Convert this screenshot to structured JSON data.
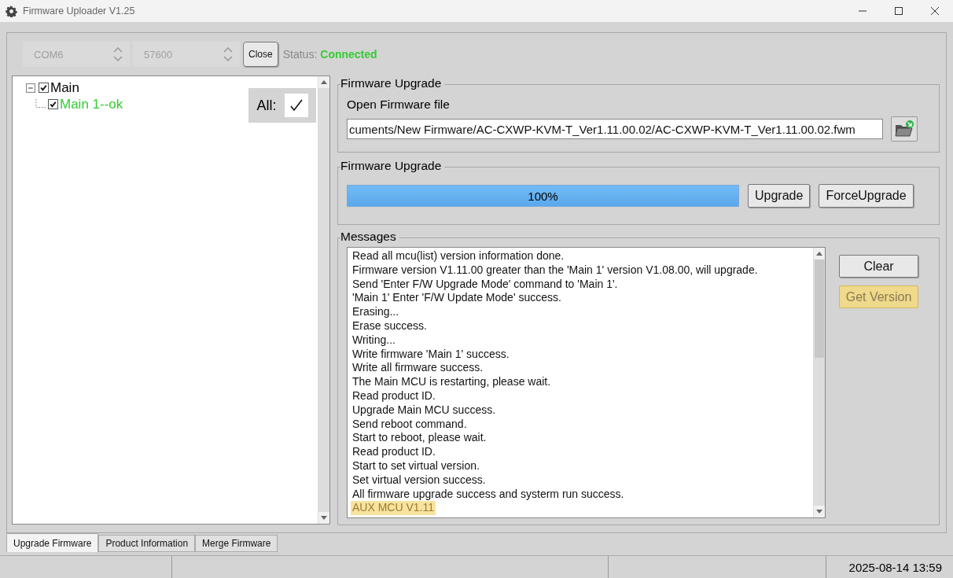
{
  "window": {
    "title": "Firmware Uploader V1.25"
  },
  "connection": {
    "port": {
      "value": "COM6",
      "disabled": true
    },
    "baud": {
      "value": "57600",
      "disabled": true
    },
    "button": "Close",
    "status_label": "Status:",
    "status_value": "Connected"
  },
  "tree": {
    "items": [
      {
        "label": "Main",
        "checked": true,
        "expanded": true,
        "children": [
          {
            "label": "Main 1--ok",
            "checked": true,
            "color": "#33cc33"
          }
        ]
      }
    ],
    "all_label": "All:",
    "all_checked": true
  },
  "file_group": {
    "title": "Firmware Upgrade",
    "label": "Open Firmware file",
    "path": "cuments/New Firmware/AC-CXWP-KVM-T_Ver1.11.00.02/AC-CXWP-KVM-T_Ver1.11.00.02.fwm"
  },
  "upgrade_group": {
    "title": "Firmware Upgrade",
    "progress": {
      "level": 1.0,
      "text": "100%"
    },
    "buttons": [
      "Upgrade",
      "ForceUpgrade"
    ]
  },
  "messages": {
    "title": "Messages",
    "lines": [
      {
        "text": "Read all mcu(list) version information done.",
        "highlighted": false
      },
      {
        "text": "Firmware version V1.11.00 greater than the 'Main 1' version V1.08.00, will upgrade.",
        "highlighted": false
      },
      {
        "text": "Send 'Enter F/W Upgrade Mode' command to 'Main 1'.",
        "highlighted": false
      },
      {
        "text": "'Main 1' Enter 'F/W Update Mode' success.",
        "highlighted": false
      },
      {
        "text": "Erasing...",
        "highlighted": false
      },
      {
        "text": "Erase success.",
        "highlighted": false
      },
      {
        "text": "Writing...",
        "highlighted": false
      },
      {
        "text": "Write firmware 'Main 1' success.",
        "highlighted": false
      },
      {
        "text": "Write all firmware success.",
        "highlighted": false
      },
      {
        "text": "The Main MCU is restarting, please wait.",
        "highlighted": false
      },
      {
        "text": "Read product ID.",
        "highlighted": false
      },
      {
        "text": "Upgrade Main MCU success.",
        "highlighted": false
      },
      {
        "text": "Send reboot command.",
        "highlighted": false
      },
      {
        "text": "Start to reboot, please wait.",
        "highlighted": false
      },
      {
        "text": "Read product ID.",
        "highlighted": false
      },
      {
        "text": "Start to set virtual version.",
        "highlighted": false
      },
      {
        "text": "Set virtual version success.",
        "highlighted": false
      },
      {
        "text": "All firmware upgrade success and systerm run success.",
        "highlighted": false
      },
      {
        "text": "AUX MCU V1.11",
        "highlighted": true
      }
    ],
    "buttons": [
      {
        "label": "Clear",
        "highlighted": false
      },
      {
        "label": "Get Version",
        "highlighted": true
      }
    ]
  },
  "tabs": [
    {
      "label": "Upgrade Firmware",
      "selected": true
    },
    {
      "label": "Product Information",
      "selected": false
    },
    {
      "label": "Merge Firmware",
      "selected": false
    }
  ],
  "status_bar": {
    "time": "2025-08-14 13:59"
  }
}
